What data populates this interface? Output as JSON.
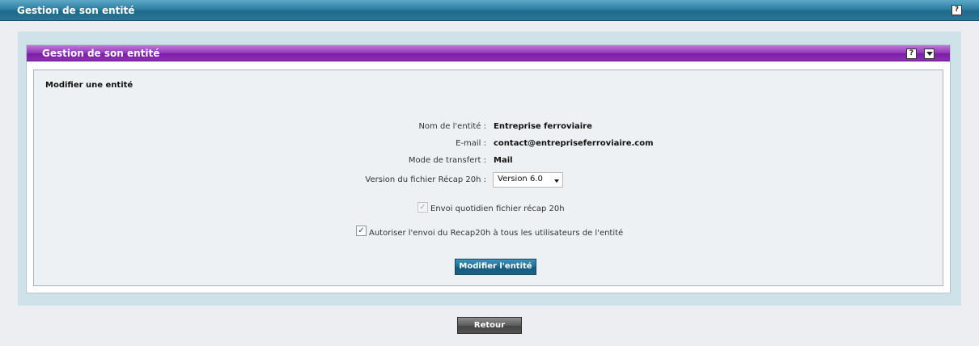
{
  "header": {
    "title": "Gestion de son entité",
    "help_label": "?"
  },
  "panel": {
    "title": "Gestion de son entité",
    "help_label": "?",
    "section_title": "Modifier une entité"
  },
  "form": {
    "name_label": "Nom de l'entité :",
    "name_value": "Entreprise ferroviaire",
    "email_label": "E-mail :",
    "email_value": "contact@entrepriseferroviaire.com",
    "transfer_label": "Mode de transfert :",
    "transfer_value": "Mail",
    "version_label": "Version du fichier Récap 20h :",
    "version_selected": "Version 6.0",
    "daily_label": "Envoi quotidien fichier récap 20h",
    "daily_checked": true,
    "daily_disabled": true,
    "allow_label": "Autoriser l'envoi du Recap20h à tous les utilisateurs de l'entité",
    "allow_checked": true,
    "submit_label": "Modifier l'entité"
  },
  "footer": {
    "back_label": "Retour"
  },
  "colors": {
    "header_blue": "#2e7fa3",
    "panel_purple": "#9238b8",
    "container_blue": "#cfe2ea"
  }
}
